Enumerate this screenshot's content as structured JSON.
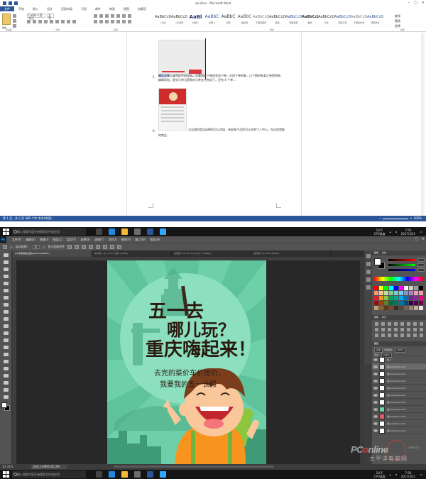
{
  "word": {
    "title": "spl.docx - Microsoft Word",
    "tabs": [
      "文件",
      "开始",
      "插入",
      "设计",
      "页面布局",
      "引用",
      "邮件",
      "审阅",
      "视图",
      "加载项"
    ],
    "ribbon": {
      "paste": "粘贴",
      "font_name": "Calibri (西文正",
      "font_size": "五号",
      "styles": [
        {
          "preview": "AaBbCcDd",
          "name": "↵正文"
        },
        {
          "preview": "AaBbCcDd",
          "name": "↵无间隔"
        },
        {
          "preview": "AaBl",
          "name": "标题 1"
        },
        {
          "preview": "AaBbC",
          "name": "标题 2"
        },
        {
          "preview": "AaBbC",
          "name": "标题"
        },
        {
          "preview": "AaBbC",
          "name": "副标题"
        },
        {
          "preview": "AaBbCcDd",
          "name": "不明显强调"
        },
        {
          "preview": "AaBbCcDd",
          "name": "强调"
        },
        {
          "preview": "AaBbCcDd",
          "name": "明显强调"
        },
        {
          "preview": "AaBbCcDd",
          "name": "要点"
        },
        {
          "preview": "AaBbCcDd",
          "name": "引用"
        },
        {
          "preview": "AaBbCcDd",
          "name": "明显引用"
        },
        {
          "preview": "AaBbCcDd",
          "name": "不明显参考"
        },
        {
          "preview": "AaBbCcDd",
          "name": "明显参考"
        }
      ],
      "groups": [
        "剪贴板",
        "字体",
        "段落",
        "样式",
        "编辑"
      ],
      "edit": [
        "查找",
        "替换",
        "选择"
      ]
    },
    "doc": {
      "item5_num": "5.",
      "item5_highlight": "确认订单",
      "item5_text": "上填写好手机号码，可看到以下单的状态下单，在线下单的新，以下期间有某订单得到呢，编辑添加，提交订单当直购对订单支付完成了，还有 4 个单...",
      "item6_num": "6.",
      "item6_text": "点击我的商品选择的可以添加，有很多产品你可以在到个人中心，在这里就能看到我们自己购买的产品...",
      "item6_text2": "的商品..."
    },
    "status": {
      "left": "第 1 页，共 2 页   685 个字   中文(中国)",
      "zoom": "100%"
    }
  },
  "taskbar": {
    "search_placeholder": "输入搜索内容开始搜索文件或应用",
    "tray_temp": "18°C",
    "tray_cpu": "CPU温度",
    "time": "7:56",
    "date": "2017/3/21"
  },
  "ps": {
    "menus": [
      "文件(F)",
      "编辑(E)",
      "图像(I)",
      "图层(L)",
      "类型(Y)",
      "选择(S)",
      "滤镜(T)",
      "3D(D)",
      "视图(V)",
      "窗口(W)",
      "帮助(H)"
    ],
    "options": [
      "自动选择：",
      "组",
      "显示变换控件"
    ],
    "tabs": [
      "psd手机新版主图@100% (RGB/8) *",
      "未标题-1 @ 33.3% (背景, RGB/8)",
      "未标题-2 @ 33.3% (Layer 0, RGB/8)",
      "未标题-3 @ 50% (RGB/8)"
    ],
    "status_zoom": "33.33%",
    "status_timeline": "文档:3.89M/105.2M",
    "poster": {
      "line1": "五一去",
      "line2": "哪儿玩？",
      "line3": "重庆嗨起来！",
      "sub1": "去完的菜价车价房价，",
      "sub2": "我要我的五一长假"
    },
    "panels": {
      "color_tab": "颜色",
      "swatch_tab": "色板",
      "adjust_tab": "调整",
      "style_tab": "样式",
      "layers_tab": "图层",
      "blend": "正常",
      "opacity_label": "不透明度：",
      "opacity": "100%",
      "fill_label": "填充：",
      "fill": "100%",
      "layers": [
        "组 1",
        "组(xx.jhmao.com)",
        "组(xx.jhmao.com)",
        "组(xx.jhmao.com)",
        "组(xx.jhmao.com)",
        "组(xx.jhmao.com)",
        "组(xx.jhmao.com)",
        "组(xx.jhmao.com)",
        "组(xx.jhmao.com)",
        "组(xx.jhmao.com)",
        "组(xx.jhmao.com)"
      ]
    }
  },
  "watermark": {
    "brand_left": "PC",
    "brand_right": "nline",
    "domain": ".com.cn",
    "tagline": "太平洋电脑网"
  },
  "colors": {
    "word_blue": "#2b579a",
    "poster_bg": "#6ed0a9",
    "ps_bg": "#282828"
  }
}
